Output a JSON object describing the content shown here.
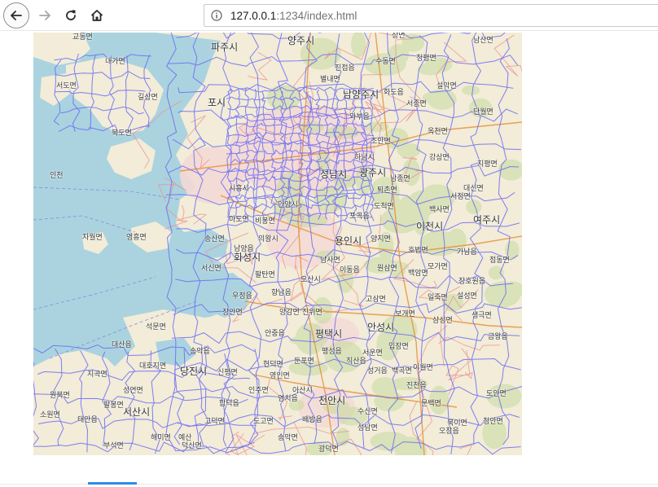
{
  "browser": {
    "url_host": "127.0.0.1",
    "url_rest": ":1234/index.html",
    "icons": {
      "back": "back-arrow-icon",
      "forward": "forward-arrow-icon",
      "reload": "reload-icon",
      "home": "home-icon",
      "info": "info-icon"
    }
  },
  "map": {
    "colors": {
      "sea": "#aad3df",
      "land": "#f2ecd8",
      "urban": "#f3d9d6",
      "forest": "#c8dca8",
      "boundary": "#6a6af5",
      "road": "#ef8a86",
      "highway": "#e8923b"
    },
    "labels": [
      {
        "id": "gyodong",
        "text": "교동면"
      },
      {
        "id": "naega",
        "text": "내가면"
      },
      {
        "id": "seodo",
        "text": "서도면"
      },
      {
        "id": "gilsang",
        "text": "길상면"
      },
      {
        "id": "bukdo",
        "text": "북도면"
      },
      {
        "id": "incheon",
        "text": "인천"
      },
      {
        "id": "jawol",
        "text": "자월면"
      },
      {
        "id": "yeongheung",
        "text": "영흥면"
      },
      {
        "id": "paju",
        "text": "파주시"
      },
      {
        "id": "yangju",
        "text": "양주시"
      },
      {
        "id": "gimpo",
        "text": "포시"
      },
      {
        "id": "siheung",
        "text": "시흥시"
      },
      {
        "id": "anyang",
        "text": "안양시"
      },
      {
        "id": "seongnam",
        "text": "성남시"
      },
      {
        "id": "gwangju",
        "text": "광주시"
      },
      {
        "id": "namyangju",
        "text": "남양주시"
      },
      {
        "id": "hwaseong",
        "text": "화성시"
      },
      {
        "id": "yongin",
        "text": "용인시"
      },
      {
        "id": "icheon",
        "text": "이천시"
      },
      {
        "id": "yeoju",
        "text": "여주시"
      },
      {
        "id": "pyeongtaek",
        "text": "평택시"
      },
      {
        "id": "anseong",
        "text": "안성시"
      },
      {
        "id": "dangjin",
        "text": "당진시"
      },
      {
        "id": "asan",
        "text": "아산시"
      },
      {
        "id": "cheonan",
        "text": "천안시"
      },
      {
        "id": "seosan",
        "text": "서산시"
      },
      {
        "id": "sangdong",
        "text": "상면"
      },
      {
        "id": "sudong",
        "text": "수동면"
      },
      {
        "id": "cheongpyeong",
        "text": "청평면"
      },
      {
        "id": "seorak",
        "text": "설악면"
      },
      {
        "id": "seojong",
        "text": "서종면"
      },
      {
        "id": "okcheon",
        "text": "옥천면"
      },
      {
        "id": "danwol",
        "text": "단월면"
      },
      {
        "id": "gangsang",
        "text": "강상면"
      },
      {
        "id": "jipyeong",
        "text": "지평면"
      },
      {
        "id": "daesin",
        "text": "대신면"
      },
      {
        "id": "baeksa",
        "text": "백사면"
      },
      {
        "id": "gaam",
        "text": "가남읍"
      },
      {
        "id": "jeomdong",
        "text": "점동면"
      },
      {
        "id": "janghowon",
        "text": "장호원읍"
      },
      {
        "id": "seolseong",
        "text": "설성면"
      },
      {
        "id": "geumwang",
        "text": "금왕읍"
      },
      {
        "id": "saenggeuk",
        "text": "생극면"
      },
      {
        "id": "samseong",
        "text": "삼성면"
      },
      {
        "id": "iljuk",
        "text": "일죽면"
      },
      {
        "id": "baekam",
        "text": "백암면"
      },
      {
        "id": "wonsam",
        "text": "원삼면"
      },
      {
        "id": "yangji",
        "text": "양지면"
      },
      {
        "id": "hobeop",
        "text": "호법면"
      },
      {
        "id": "mogamyeon",
        "text": "모가면"
      },
      {
        "id": "gosam",
        "text": "고삼면"
      },
      {
        "id": "bogae",
        "text": "보개면"
      },
      {
        "id": "seoun",
        "text": "서운면"
      },
      {
        "id": "ipjang",
        "text": "입장면"
      },
      {
        "id": "seonggeo",
        "text": "성거읍"
      },
      {
        "id": "jiksan",
        "text": "직산읍"
      },
      {
        "id": "seokmun",
        "text": "석문면"
      },
      {
        "id": "daesan",
        "text": "대산읍"
      },
      {
        "id": "songak",
        "text": "송악읍"
      },
      {
        "id": "daeho",
        "text": "대호지면"
      },
      {
        "id": "seongyeon",
        "text": "성연면"
      },
      {
        "id": "jigok",
        "text": "지곡면"
      },
      {
        "id": "palbong",
        "text": "팔봉면"
      },
      {
        "id": "buseok",
        "text": "부석면"
      },
      {
        "id": "wonbuk",
        "text": "원북면"
      },
      {
        "id": "sowon",
        "text": "소원면"
      },
      {
        "id": "taean",
        "text": "태안읍"
      },
      {
        "id": "godeok",
        "text": "고덕면"
      },
      {
        "id": "sinpyeong",
        "text": "신평면"
      },
      {
        "id": "hapdeok",
        "text": "합덕읍"
      },
      {
        "id": "yesan",
        "text": "예산"
      },
      {
        "id": "yeomchi",
        "text": "염치읍"
      },
      {
        "id": "baebang",
        "text": "배방읍"
      },
      {
        "id": "seongnam2",
        "text": "성남면"
      },
      {
        "id": "sudongmyeon",
        "text": "수신면"
      },
      {
        "id": "gwangdeok",
        "text": "광덕면"
      },
      {
        "id": "songak2",
        "text": "송악면"
      },
      {
        "id": "haemi",
        "text": "해미면"
      },
      {
        "id": "deoksan",
        "text": "덕산면"
      },
      {
        "id": "dogo",
        "text": "도고면"
      },
      {
        "id": "ogong",
        "text": "오창읍"
      },
      {
        "id": "bugi",
        "text": "북이면"
      },
      {
        "id": "cheongan",
        "text": "청안면"
      },
      {
        "id": "doan",
        "text": "도안면"
      },
      {
        "id": "jincheon",
        "text": "진천읍"
      },
      {
        "id": "baekgok",
        "text": "백곡면"
      },
      {
        "id": "ihwol",
        "text": "이월면"
      },
      {
        "id": "namsan",
        "text": "남산면"
      },
      {
        "id": "munbaek",
        "text": "문백면"
      },
      {
        "id": "osan",
        "text": "오산시"
      },
      {
        "id": "uiwang",
        "text": "의왕시"
      },
      {
        "id": "hyeondeok",
        "text": "현덕면"
      },
      {
        "id": "anjung",
        "text": "안중읍"
      },
      {
        "id": "paengseong",
        "text": "팽성읍"
      },
      {
        "id": "dunpo",
        "text": "둔포면"
      },
      {
        "id": "yeongin",
        "text": "영인면"
      },
      {
        "id": "inju",
        "text": "인주면"
      },
      {
        "id": "ujeong",
        "text": "우정읍"
      },
      {
        "id": "paltan",
        "text": "팔탄면"
      },
      {
        "id": "hyangnam",
        "text": "향남읍"
      },
      {
        "id": "jangan",
        "text": "장안면"
      },
      {
        "id": "seosin",
        "text": "서신면"
      },
      {
        "id": "songsan",
        "text": "송산면"
      },
      {
        "id": "mado",
        "text": "마도면"
      },
      {
        "id": "namyang",
        "text": "남양읍"
      },
      {
        "id": "bibong",
        "text": "비봉면"
      },
      {
        "id": "mongsam",
        "text": "양감면"
      },
      {
        "id": "jinwi",
        "text": "진위면"
      },
      {
        "id": "idong",
        "text": "이동읍"
      },
      {
        "id": "namsa",
        "text": "남사면"
      },
      {
        "id": "pogok",
        "text": "포곡읍"
      },
      {
        "id": "docheok",
        "text": "도척면"
      },
      {
        "id": "toechon",
        "text": "퇴촌면"
      },
      {
        "id": "namjong",
        "text": "남종면"
      },
      {
        "id": "jopeon",
        "text": "조안면"
      },
      {
        "id": "hwado",
        "text": "화도읍"
      },
      {
        "id": "wabu",
        "text": "와부읍"
      },
      {
        "id": "jinjeop",
        "text": "진접읍"
      },
      {
        "id": "byeollae",
        "text": "별내면"
      },
      {
        "id": "hanam",
        "text": "하남시"
      },
      {
        "id": "seojeongni",
        "text": "서정면"
      }
    ]
  }
}
